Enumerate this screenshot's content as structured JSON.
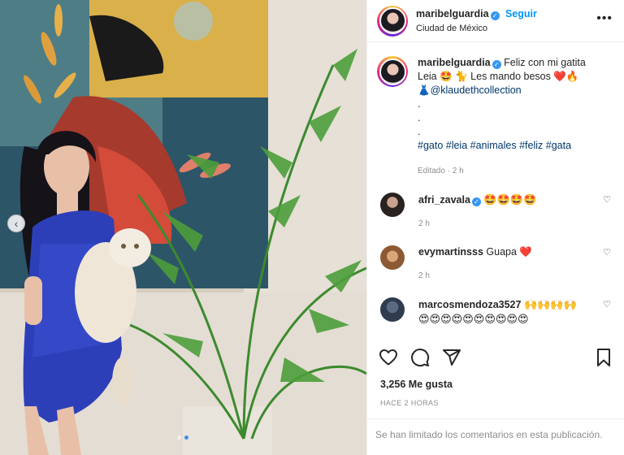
{
  "post": {
    "username": "maribelguardia",
    "follow_label": "Seguir",
    "location": "Ciudad de México",
    "more_label": "•••"
  },
  "caption": {
    "username": "maribelguardia",
    "line1": "Feliz con mi gatita",
    "line2": "Leia 🤩 🐈 Les mando besos",
    "line2_emoji": "❤️🔥",
    "line3_emoji": "👗",
    "mention": "@klaudethcollection",
    "dots": [
      ".",
      ".",
      "."
    ],
    "hashtags": "#gato #leia #animales #feliz #gata",
    "meta": "Editado · 2 h"
  },
  "comments": [
    {
      "username": "afri_zavala",
      "verified": true,
      "text": "🤩🤩🤩🤩",
      "time": "2 h"
    },
    {
      "username": "evymartinsss",
      "verified": false,
      "text": "Guapa ❤️",
      "time": "2 h"
    },
    {
      "username": "marcosmendoza3527",
      "verified": false,
      "text": "🙌🙌🙌🙌",
      "text2": "😍😍😍😍😍😍😍😍😍😍"
    }
  ],
  "engagement": {
    "likes": "3,256 Me gusta",
    "ago": "HACE 2 HORAS",
    "limited": "Se han limitado los comentarios en esta publicación."
  },
  "colors": {
    "link": "#0095f6",
    "hashtag": "#00376b",
    "muted": "#8e8e8e",
    "verified": "#3897f0"
  },
  "icons": [
    "heart-icon",
    "comment-icon",
    "share-icon",
    "save-icon",
    "more-icon",
    "verified-icon",
    "chevron-left-icon"
  ]
}
